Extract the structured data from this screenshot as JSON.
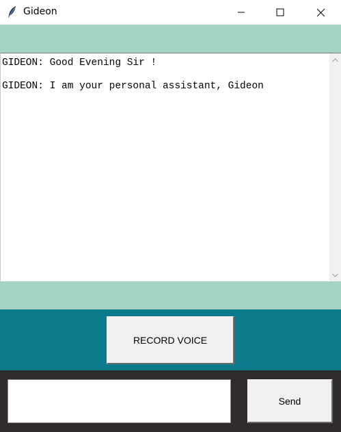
{
  "window": {
    "title": "Gideon",
    "icon": "feather-icon"
  },
  "chat": {
    "lines": [
      "GIDEON: Good Evening Sir !",
      "GIDEON: I am your personal assistant, Gideon"
    ]
  },
  "controls": {
    "record_label": "RECORD VOICE",
    "message_value": "",
    "send_label": "Send"
  },
  "colors": {
    "mint": "#a3d4c5",
    "teal": "#0b7a8a",
    "dark": "#302c2c",
    "button": "#f0f0f0"
  }
}
